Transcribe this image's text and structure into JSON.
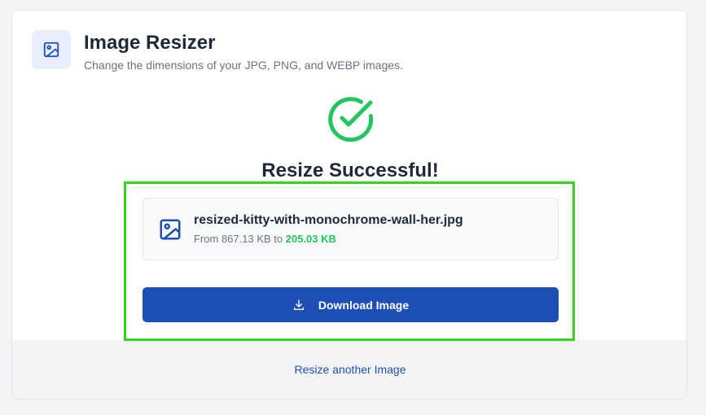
{
  "header": {
    "title": "Image Resizer",
    "subtitle": "Change the dimensions of your JPG, PNG, and WEBP images.",
    "icon": "image-icon"
  },
  "result": {
    "status_icon": "check-circle-icon",
    "heading": "Resize Successful!",
    "file": {
      "icon": "image-icon",
      "name": "resized-kitty-with-monochrome-wall-her.jpg",
      "from_prefix": "From ",
      "original_size": "867.13 KB",
      "to_word": " to ",
      "new_size": "205.03 KB"
    },
    "download_button": {
      "icon": "download-icon",
      "label": "Download Image"
    }
  },
  "footer": {
    "link_label": "Resize another Image"
  },
  "colors": {
    "primary": "#1e4fb5",
    "success": "#22c55e",
    "highlight": "#36d41c"
  }
}
